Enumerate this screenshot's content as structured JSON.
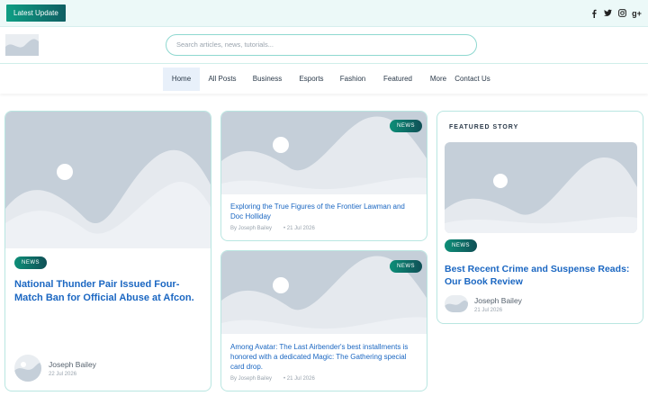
{
  "topbar": {
    "latest_label": "Latest Update",
    "socials": [
      {
        "name": "facebook-icon",
        "glyph": "f"
      },
      {
        "name": "twitter-icon",
        "glyph": ""
      },
      {
        "name": "instagram-icon",
        "glyph": ""
      },
      {
        "name": "google-plus-icon",
        "glyph": "g+"
      }
    ]
  },
  "header": {
    "search_placeholder": "Search articles, news, tutorials..."
  },
  "nav": {
    "items": [
      "Home",
      "All Posts",
      "Business",
      "Esports",
      "Fashion",
      "Featured",
      "More",
      "Contact Us"
    ],
    "active": "Home"
  },
  "cards": {
    "main": {
      "badge": "NEWS",
      "title": "National Thunder Pair Issued Four-Match Ban for Official Abuse at Afcon.",
      "author": "Joseph Bailey",
      "date": "22 Jul 2026"
    },
    "middle_top": {
      "badge": "NEWS",
      "title": "Exploring the True Figures of the Frontier Lawman and Doc Holliday",
      "author": "By Joseph Bailey",
      "date": "• 21 Jul 2026"
    },
    "middle_bottom": {
      "badge": "NEWS",
      "title": "Among Avatar: The Last Airbender's best installments is honored with a dedicated Magic: The Gathering special card drop.",
      "author": "By Joseph Bailey",
      "date": "• 21 Jul 2026"
    },
    "featured": {
      "label": "FEATURED STORY",
      "badge": "NEWS",
      "title": "Best Recent Crime and Suspense Reads: Our Book Review",
      "author": "Joseph Bailey",
      "date": "21 Jul 2026"
    }
  },
  "colors": {
    "accent": "#1b67c2",
    "badge_start": "#0e8f78",
    "badge_end": "#0f4f56",
    "border": "#b9e6e1",
    "topbar_bg": "#ecf9f8",
    "placeholder_bg": "#c5cfd9"
  }
}
